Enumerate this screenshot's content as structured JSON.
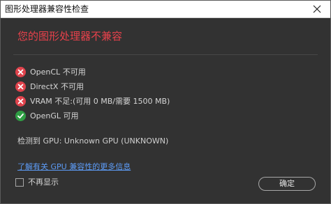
{
  "window": {
    "title": "图形处理器兼容性检查"
  },
  "dialog": {
    "heading": "您的图形处理器不兼容",
    "checks": [
      {
        "name": "OpenCL",
        "status": "不可用",
        "state": "fail"
      },
      {
        "name": "DirectX",
        "status": "不可用",
        "state": "fail"
      },
      {
        "name": "VRAM",
        "status": "不足:(可用 0 MB/需要 1500 MB)",
        "state": "fail"
      },
      {
        "name": "OpenGL",
        "status": "可用",
        "state": "pass"
      }
    ],
    "detected_label": "检测到 GPU:",
    "detected_value": "Unknown GPU (UNKNOWN)",
    "learn_more_link": "了解有关 GPU 兼容性的更多信息",
    "dont_show_label": "不再显示",
    "dont_show_checked": false,
    "ok_label": "确定"
  },
  "colors": {
    "background": "#323232",
    "heading": "#e8414b",
    "fail_icon": "#e0434c",
    "pass_icon": "#2f9e44",
    "link": "#5d9cf7"
  },
  "icons": {
    "fail": "error-x-circle-icon",
    "pass": "check-circle-icon",
    "close": "close-icon"
  }
}
